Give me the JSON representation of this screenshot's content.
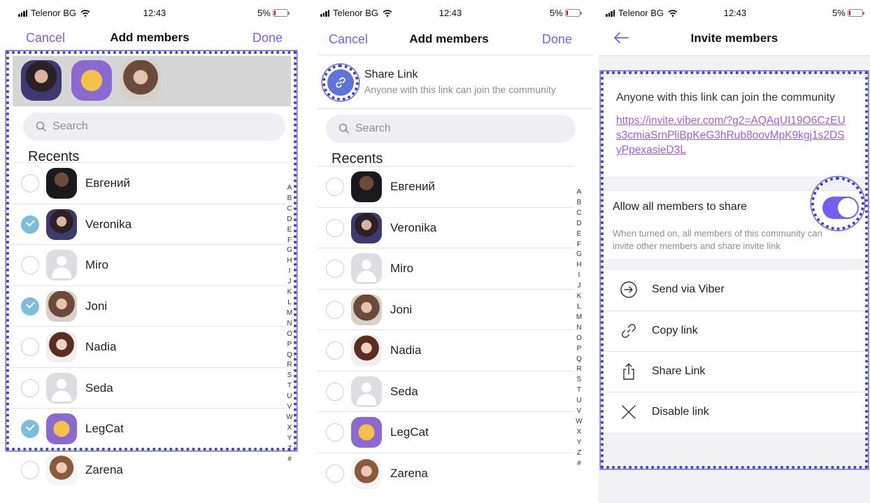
{
  "status": {
    "carrier": "Telenor BG",
    "time": "12:43",
    "battery": "5%"
  },
  "add_members": {
    "cancel": "Cancel",
    "title": "Add members",
    "done": "Done",
    "search_placeholder": "Search",
    "recents": "Recents",
    "share_link_title": "Share Link",
    "share_link_subtitle": "Anyone with this link can join the community",
    "contacts": [
      "Евгений",
      "Veronika",
      "Miro",
      "Joni",
      "Nadia",
      "Seda",
      "LegCat",
      "Zarena"
    ],
    "selected_in_panel1": [
      "Veronika",
      "Joni",
      "LegCat"
    ],
    "index_letters": [
      "A",
      "B",
      "C",
      "D",
      "E",
      "F",
      "G",
      "H",
      "I",
      "J",
      "K",
      "L",
      "M",
      "N",
      "O",
      "P",
      "Q",
      "R",
      "S",
      "T",
      "U",
      "V",
      "W",
      "X",
      "Y",
      "Z",
      "#"
    ]
  },
  "invite": {
    "title": "Invite members",
    "intro": "Anyone with this link can join the community",
    "link": "https://invite.viber.com/?g2=AQAqUI19O6CzEUs3cmiaSrnPliBpKeG3hRub8oovMpK9kgj1s2DSyPpexasieD3L",
    "allow_label": "Allow all members to share",
    "allow_on": true,
    "allow_desc": "When turned on, all members of this community can invite other members and share invite link",
    "actions": [
      {
        "label": "Send via Viber",
        "icon": "send-via-viber-icon"
      },
      {
        "label": "Copy link",
        "icon": "link-icon"
      },
      {
        "label": "Share Link",
        "icon": "share-icon"
      },
      {
        "label": "Disable link",
        "icon": "close-icon"
      }
    ]
  },
  "colors": {
    "accent": "#7360f2",
    "check": "#7fbcd9",
    "link": "#a260d0",
    "highlight": "#3f3fc6"
  }
}
